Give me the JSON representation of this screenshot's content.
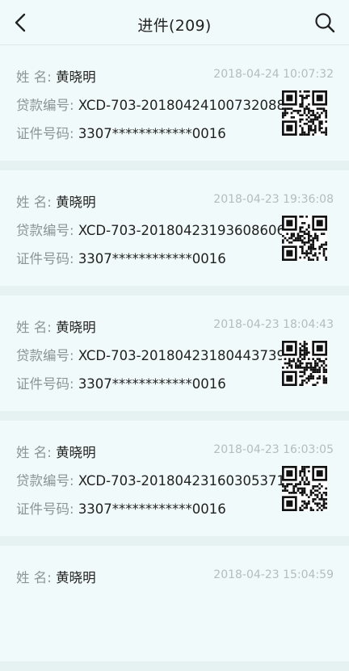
{
  "header": {
    "title": "进件(209)",
    "back_icon": "chevron-left-icon",
    "search_icon": "search-icon"
  },
  "labels": {
    "name": "姓 名:",
    "loan_no": "贷款编号:",
    "id_no": "证件号码:"
  },
  "records": [
    {
      "name": "黄晓明",
      "time": "2018-04-24 10:07:32",
      "loan_no": "XCD-703-20180424100732088",
      "id_no": "3307************0016"
    },
    {
      "name": "黄晓明",
      "time": "2018-04-23 19:36:08",
      "loan_no": "XCD-703-20180423193608606",
      "id_no": "3307************0016"
    },
    {
      "name": "黄晓明",
      "time": "2018-04-23 18:04:43",
      "loan_no": "XCD-703-20180423180443739",
      "id_no": "3307************0016"
    },
    {
      "name": "黄晓明",
      "time": "2018-04-23 16:03:05",
      "loan_no": "XCD-703-20180423160305371",
      "id_no": "3307************0016"
    },
    {
      "name": "黄晓明",
      "time": "2018-04-23 15:04:59"
    }
  ]
}
